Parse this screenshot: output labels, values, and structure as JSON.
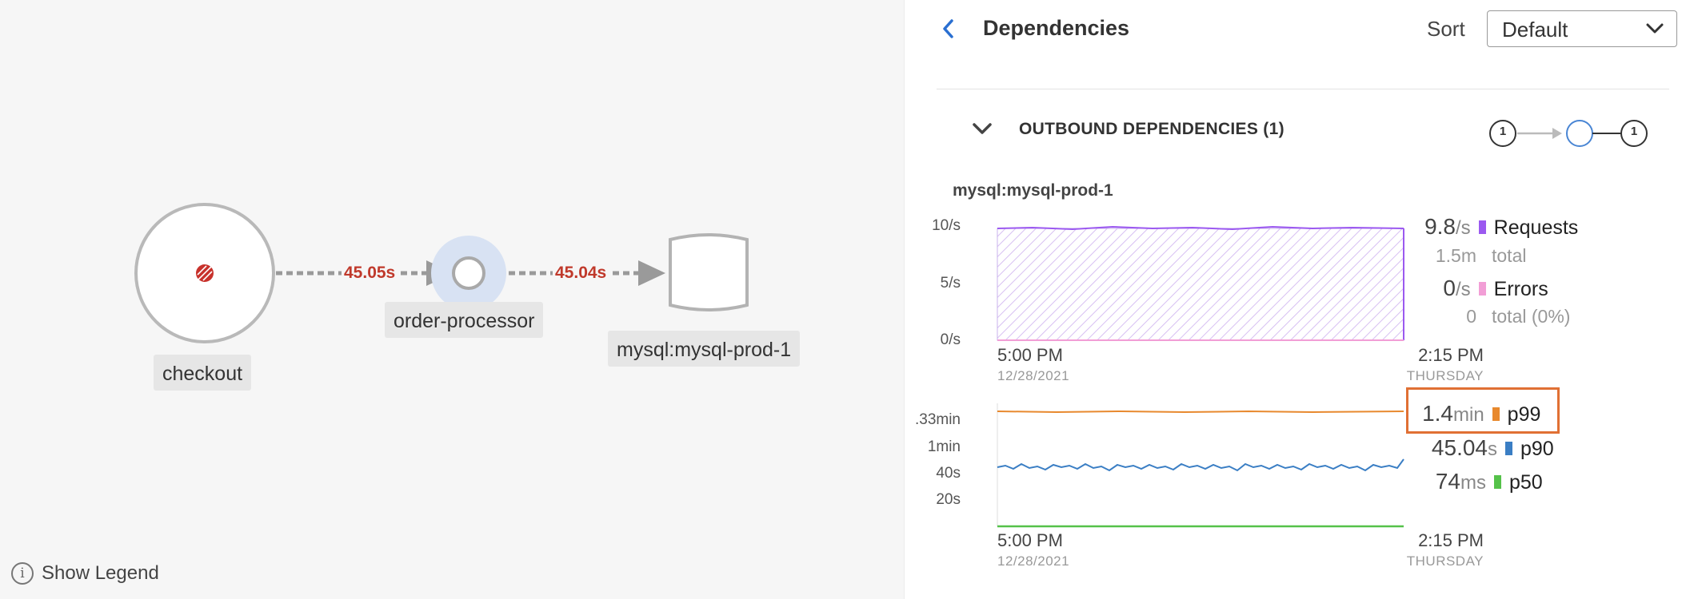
{
  "graph": {
    "nodes": {
      "checkout": "checkout",
      "order_processor": "order-processor",
      "mysql": "mysql:mysql-prod-1"
    },
    "edges": [
      "45.05s",
      "45.04s"
    ],
    "legend_button": "Show Legend"
  },
  "panel": {
    "title": "Dependencies",
    "sort_label": "Sort",
    "sort_value": "Default",
    "section_title": "OUTBOUND DEPENDENCIES (1)",
    "mini_graph": {
      "left_count": "1",
      "right_count": "1"
    },
    "dependency_name": "mysql:mysql-prod-1",
    "chart1": {
      "y_ticks": [
        "10/s",
        "5/s",
        "0/s"
      ],
      "x_start": "5:00 PM",
      "x_start_sub": "12/28/2021",
      "x_end": "2:15 PM",
      "x_end_sub": "THURSDAY"
    },
    "chart2": {
      "y_ticks": [
        ".33min",
        "1min",
        "40s",
        "20s"
      ],
      "x_start": "5:00 PM",
      "x_start_sub": "12/28/2021",
      "x_end": "2:15 PM",
      "x_end_sub": "THURSDAY"
    },
    "stats": {
      "requests": {
        "value": "9.8",
        "unit": "/s",
        "label": "Requests",
        "total": "1.5m",
        "total_label": "total"
      },
      "errors": {
        "value": "0",
        "unit": "/s",
        "label": "Errors",
        "total": "0",
        "total_label": "total (0%)"
      },
      "p99": {
        "value": "1.4",
        "unit": "min",
        "label": "p99"
      },
      "p90": {
        "value": "45.04",
        "unit": "s",
        "label": "p90"
      },
      "p50": {
        "value": "74",
        "unit": "ms",
        "label": "p50"
      }
    },
    "colors": {
      "requests": "#9b59f0",
      "errors": "#f29ed6",
      "p99": "#e8892e",
      "p90": "#3a7ec4",
      "p50": "#55c24a",
      "edge_label": "#c0392b",
      "highlight": "#e07034"
    }
  }
}
